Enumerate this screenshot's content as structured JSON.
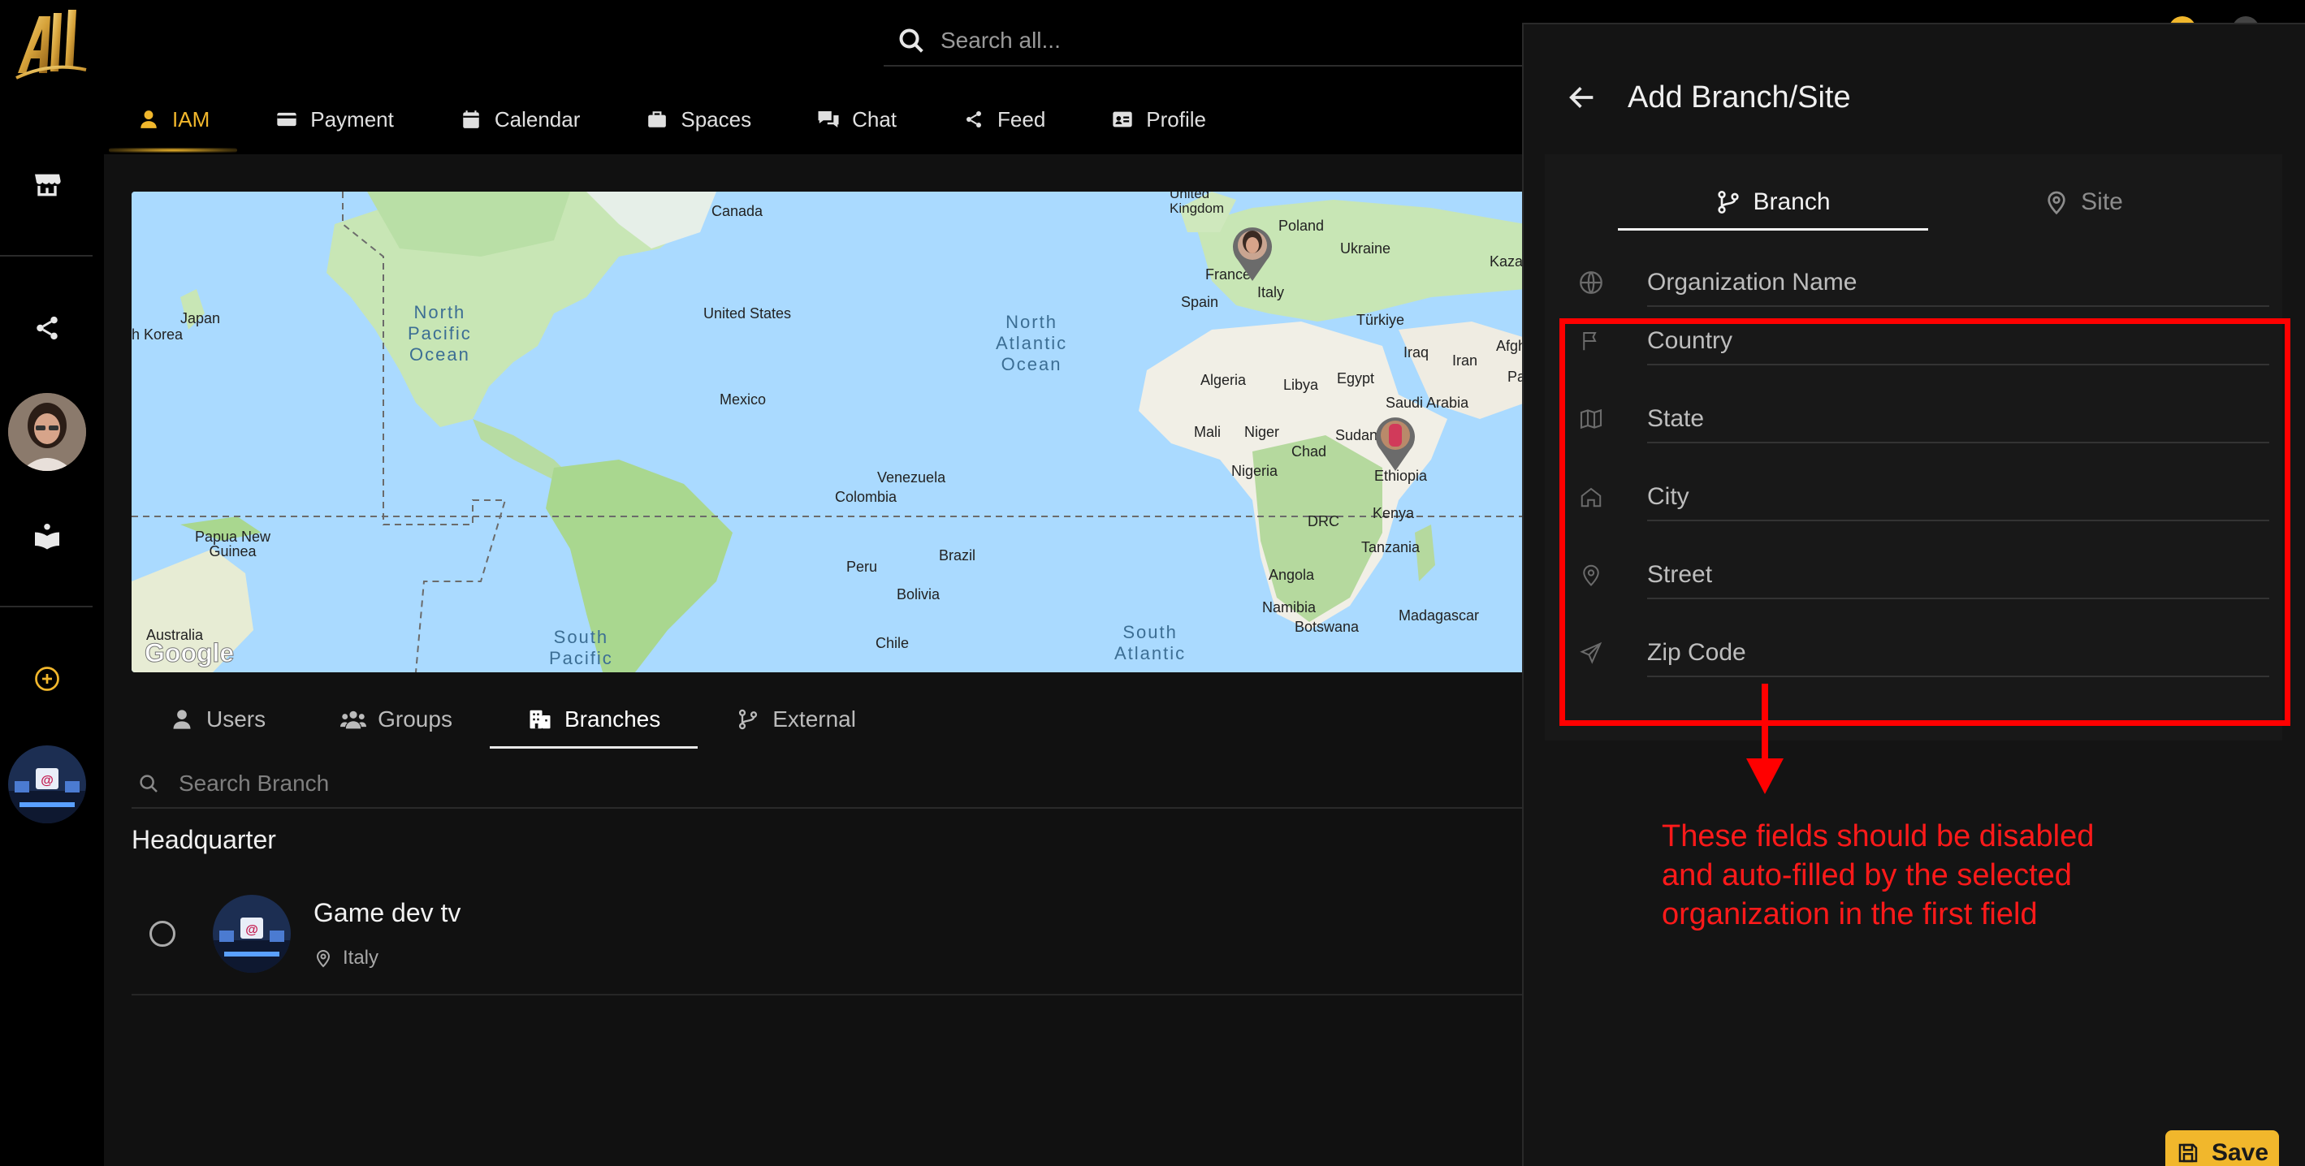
{
  "app": {
    "logo_text": "All"
  },
  "search": {
    "placeholder": "Search all..."
  },
  "nav": [
    {
      "label": "IAM",
      "icon": "user-icon"
    },
    {
      "label": "Payment",
      "icon": "credit-card-icon"
    },
    {
      "label": "Calendar",
      "icon": "calendar-icon"
    },
    {
      "label": "Spaces",
      "icon": "briefcase-icon"
    },
    {
      "label": "Chat",
      "icon": "chat-bubbles-icon"
    },
    {
      "label": "Feed",
      "icon": "share-icon"
    },
    {
      "label": "Profile",
      "icon": "id-card-icon"
    }
  ],
  "map": {
    "labels": {
      "canada": "Canada",
      "united_kingdom": "United\nKingdom",
      "poland": "Poland",
      "ukraine": "Ukraine",
      "kaza": "Kaza",
      "france": "France",
      "italy": "Italy",
      "spain": "Spain",
      "turkiye": "Türkiye",
      "iraq": "Iraq",
      "iran": "Iran",
      "afgh": "Afgh",
      "japan": "Japan",
      "south_korea": "h Korea",
      "north_pacific": "North\nPacific\nOcean",
      "united_states": "United States",
      "north_atlantic": "North\nAtlantic\nOcean",
      "algeria": "Algeria",
      "libya": "Libya",
      "egypt": "Egypt",
      "saudi_arabia": "Saudi Arabia",
      "pa": "Pa",
      "mexico": "Mexico",
      "mali": "Mali",
      "niger": "Niger",
      "chad": "Chad",
      "sudan": "Sudan",
      "ethiopia": "Ethiopia",
      "nigeria": "Nigeria",
      "venezuela": "Venezuela",
      "colombia": "Colombia",
      "kenya": "Kenya",
      "drc": "DRC",
      "tanzania": "Tanzania",
      "papua": "Papua New\nGuinea",
      "peru": "Peru",
      "brazil": "Brazil",
      "bolivia": "Bolivia",
      "angola": "Angola",
      "namibia": "Namibia",
      "botswana": "Botswana",
      "madagascar": "Madagascar",
      "australia": "Australia",
      "chile": "Chile",
      "south_pacific": "South\nPacific",
      "south_atlantic": "South\nAtlantic",
      "google": "Google"
    }
  },
  "tabs": [
    {
      "label": "Users",
      "icon": "user-icon"
    },
    {
      "label": "Groups",
      "icon": "users-icon"
    },
    {
      "label": "Branches",
      "icon": "building-icon"
    },
    {
      "label": "External",
      "icon": "branch-icon"
    }
  ],
  "branch_search": {
    "placeholder": "Search Branch"
  },
  "list": {
    "section_title": "Headquarter",
    "items": [
      {
        "name": "Game dev tv",
        "location": "Italy"
      }
    ]
  },
  "drawer": {
    "title": "Add Branch/Site",
    "tabs": [
      {
        "label": "Branch"
      },
      {
        "label": "Site"
      }
    ],
    "fields": [
      {
        "label": "Organization Name",
        "icon": "globe-icon"
      },
      {
        "label": "Country",
        "icon": "flag-icon"
      },
      {
        "label": "State",
        "icon": "map-icon"
      },
      {
        "label": "City",
        "icon": "home-icon"
      },
      {
        "label": "Street",
        "icon": "pin-icon"
      },
      {
        "label": "Zip Code",
        "icon": "send-icon"
      }
    ],
    "save_label": "Save"
  },
  "annotation": {
    "text": "These fields should be disabled\nand auto-filled by the selected\norganization in the first field",
    "color": "#ff0000"
  },
  "colors": {
    "accent": "#f1b72c",
    "background": "#000000",
    "panel": "#111111"
  }
}
